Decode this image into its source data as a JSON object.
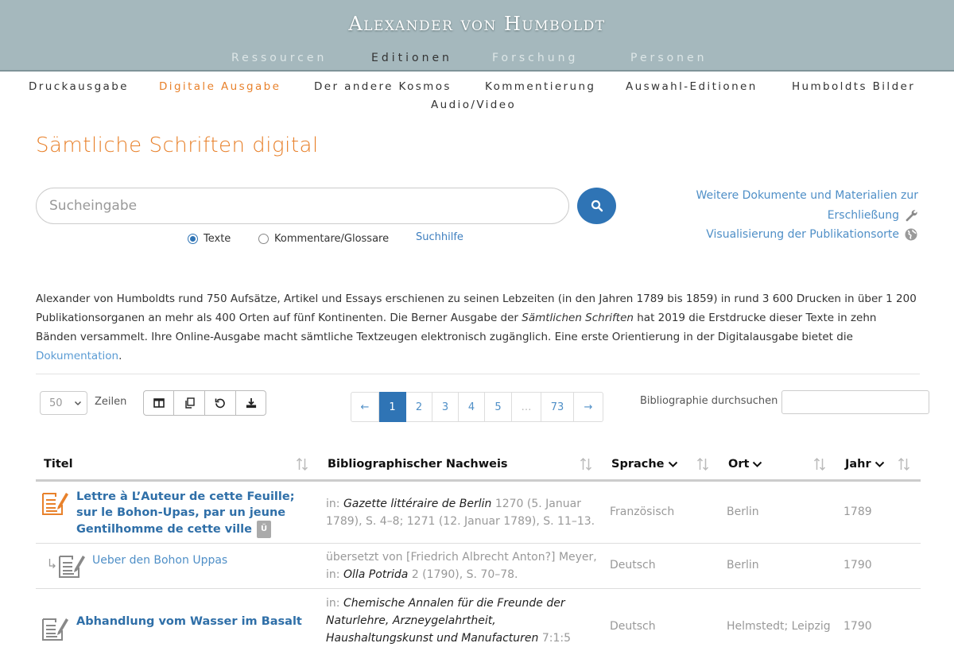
{
  "header": {
    "site_title": "Alexander von Humboldt",
    "nav": [
      "Ressourcen",
      "Editionen",
      "Forschung",
      "Personen"
    ],
    "active_nav": "Editionen"
  },
  "subnav": {
    "items": [
      "Druckausgabe",
      "Digitale Ausgabe",
      "Der andere Kosmos",
      "Kommentierung",
      "Auswahl-Editionen",
      "Humboldts Bilder",
      "Audio/Video"
    ],
    "active": "Digitale Ausgabe"
  },
  "page_title": "Sämtliche Schriften digital",
  "search": {
    "placeholder": "Sucheingabe",
    "options": [
      {
        "label": "Texte",
        "selected": true
      },
      {
        "label": "Kommentare/Glossare",
        "selected": false
      }
    ],
    "help_label": "Suchhilfe"
  },
  "side_links": {
    "docs_line1": "Weitere Dokumente und Materialien zur",
    "docs_line2": "Erschließung",
    "viz": "Visualisierung der Publikationsorte"
  },
  "intro": {
    "part1": "Alexander von Humboldts rund 750 Aufsätze, Artikel und Essays erschienen zu seinen Lebzeiten (in den Jahren 1789 bis 1859) in rund 3 600 Drucken in über 1 200 Publikationsorganen an mehr als 400 Orten auf fünf Kontinenten. Die Berner Ausgabe der ",
    "italic": "Sämtlichen Schriften",
    "part2": " hat 2019 die Erstdrucke dieser Texte in zehn Bänden versammelt. Ihre Online-Ausgabe macht sämtliche Textzeugen elektronisch zugänglich. Eine erste Orientierung in der Digitalausgabe bietet die ",
    "link": "Dokumentation",
    "part3": "."
  },
  "table_controls": {
    "rows_value": "50",
    "rows_label": "Zeilen",
    "pagination": [
      "←",
      "1",
      "2",
      "3",
      "4",
      "5",
      "…",
      "73",
      "→"
    ],
    "current_page": "1",
    "bib_search_label": "Bibliographie durchsuchen"
  },
  "columns": {
    "titel": "Titel",
    "nachweis": "Bibliographischer Nachweis",
    "sprache": "Sprache",
    "ort": "Ort",
    "jahr": "Jahr"
  },
  "rows": [
    {
      "title": "Lettre à L’Auteur de cette Feuille; sur le Bohon-Upas, par un jeune Gentilhomme de cette ville",
      "badge": "Ü",
      "cite_prefix": "in: ",
      "cite_italic": "Gazette littéraire de Berlin",
      "cite_rest": " 1270 (5. Januar 1789), S. 4–8; 1271 (12. Januar 1789), S. 11–13.",
      "sprache": "Französisch",
      "ort": "Berlin",
      "jahr": "1789"
    },
    {
      "title": "Ueber den Bohon Uppas",
      "cite_prefix": "übersetzt von [Friedrich Albrecht Anton?] Meyer, in: ",
      "cite_italic": "Olla Potrida",
      "cite_rest": " 2 (1790), S. 70–78.",
      "sprache": "Deutsch",
      "ort": "Berlin",
      "jahr": "1790"
    },
    {
      "title": "Abhandlung vom Wasser im Basalt",
      "cite_prefix": "in: ",
      "cite_italic": "Chemische Annalen für die Freunde der Naturlehre, Arzneygelahrtheit, Haushaltungskunst und Manufacturen",
      "cite_rest": " 7:1:5",
      "sprache": "Deutsch",
      "ort": "Helmstedt; Leipzig",
      "jahr": "1790"
    }
  ],
  "colors": {
    "header_bg": "#a5b8bd",
    "accent_orange": "#e8812b",
    "primary_blue": "#2f74b5",
    "link_blue": "#4f8fc7"
  }
}
